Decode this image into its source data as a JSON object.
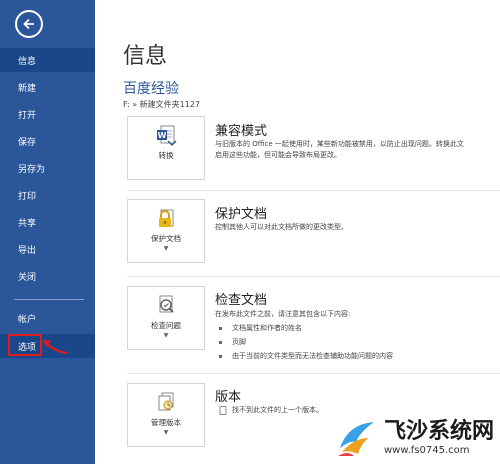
{
  "sidebar": {
    "back_label": "",
    "items": [
      {
        "label": "信息"
      },
      {
        "label": "新建"
      },
      {
        "label": "打开"
      },
      {
        "label": "保存"
      },
      {
        "label": "另存为"
      },
      {
        "label": "打印"
      },
      {
        "label": "共享"
      },
      {
        "label": "导出"
      },
      {
        "label": "关闭"
      },
      {
        "label": "帐户"
      },
      {
        "label": "选项"
      }
    ]
  },
  "main": {
    "title": "信息",
    "doc_name": "百度经验",
    "doc_path": "F: » 新建文件夹1127",
    "sections": [
      {
        "button_label": "转换",
        "title": "兼容模式",
        "desc1": "与旧版本的 Office 一起使用时，某些新功能被禁用，以防止出现问题。转换此文",
        "desc2": "启用这些功能，但可能会导致布局更改。"
      },
      {
        "button_label": "保护文档",
        "title": "保护文档",
        "desc1": "控制其他人可以对此文档所做的更改类型。"
      },
      {
        "button_label": "检查问题",
        "title": "检查文档",
        "desc1": "在发布此文件之前，请注意其包含以下内容:",
        "bullets": [
          "文档属性和作者的姓名",
          "页脚",
          "由于当前的文件类型而无法检查辅助功能问题的内容"
        ]
      },
      {
        "button_label": "管理版本",
        "title": "版本",
        "desc1": "找不到此文件的上一个版本。"
      }
    ]
  },
  "watermark": {
    "title": "飞沙系统网",
    "url": "www.fs0745.com"
  },
  "colors": {
    "sidebar": "#2b579a",
    "accent": "#2b579a",
    "highlight": "#e01b1b"
  }
}
